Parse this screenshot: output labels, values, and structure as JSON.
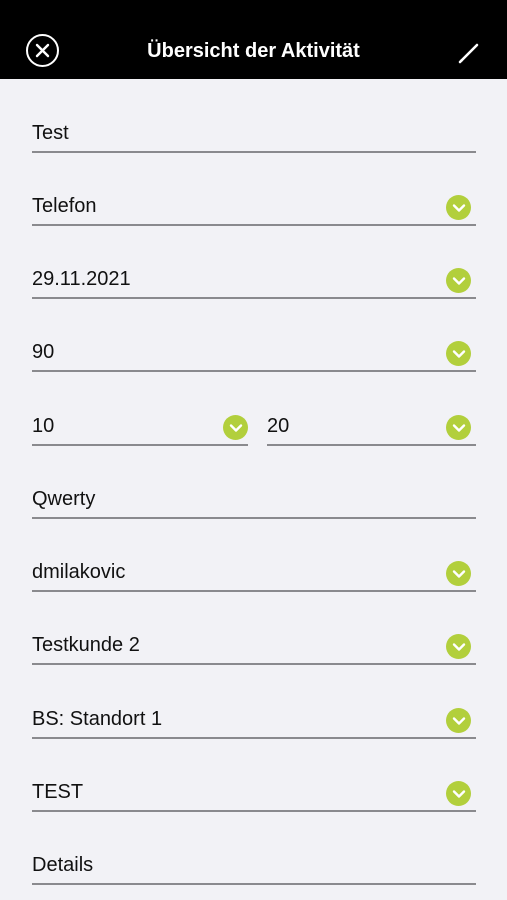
{
  "header": {
    "title": "Übersicht der Aktivität",
    "close_icon": "close-icon",
    "edit_icon": "pencil-icon"
  },
  "fields": {
    "subject": "Test",
    "type": "Telefon",
    "date": "29.11.2021",
    "duration": "90",
    "time_from": "10",
    "time_to": "20",
    "description": "Qwerty",
    "user": "dmilakovic",
    "customer": "Testkunde 2",
    "location": "BS: Standort 1",
    "project": "TEST",
    "details": "Details"
  },
  "colors": {
    "accent": "#b2cf3c",
    "header_bg": "#000000",
    "page_bg": "#f2f2f6"
  }
}
